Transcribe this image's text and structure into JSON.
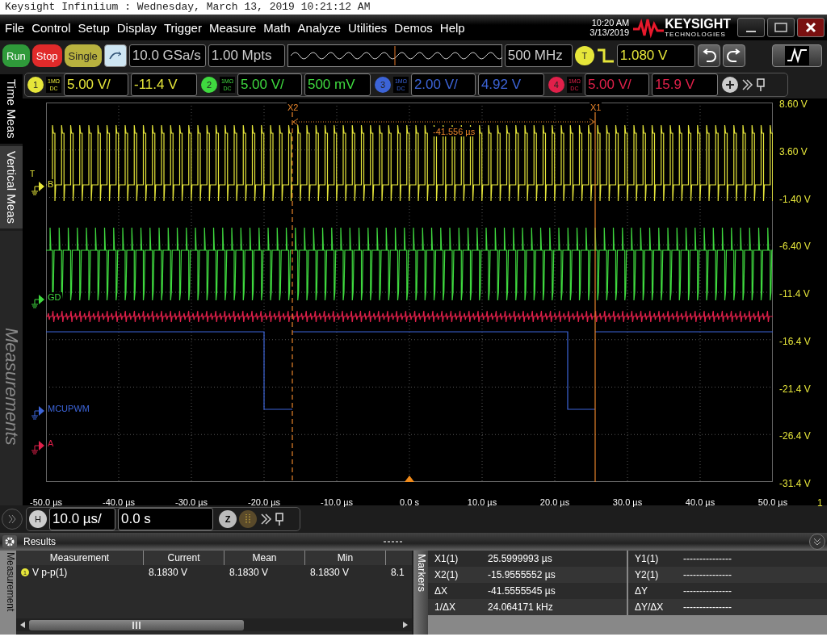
{
  "window_title": "Keysight Infiniium : Wednesday, March 13, 2019 10:21:12 AM",
  "menu": [
    "File",
    "Control",
    "Setup",
    "Display",
    "Trigger",
    "Measure",
    "Math",
    "Analyze",
    "Utilities",
    "Demos",
    "Help"
  ],
  "clock": {
    "time": "10:20 AM",
    "date": "3/13/2019"
  },
  "logo": {
    "name": "KEYSIGHT",
    "subtitle": "TECHNOLOGIES"
  },
  "acquisition": {
    "buttons": [
      {
        "label": "Run",
        "kind": "run"
      },
      {
        "label": "Stop",
        "kind": "stop"
      },
      {
        "label": "Single",
        "kind": "single"
      }
    ],
    "sample_rate": "10.0 GSa/s",
    "memory_depth": "1.00 Mpts",
    "bandwidth": "500 MHz"
  },
  "trigger": {
    "badge": "T",
    "level": "1.080 V",
    "marker": "T"
  },
  "channels": [
    {
      "number": "1",
      "impedance": "1MΩ",
      "coupling": "DC",
      "scale": "5.00 V/",
      "offset": "-11.4 V",
      "label": "B",
      "color": "#e6e63a"
    },
    {
      "number": "2",
      "impedance": "1MΩ",
      "coupling": "DC",
      "scale": "5.00 V/",
      "offset": "500 mV",
      "label": "GD",
      "color": "#3fd93f"
    },
    {
      "number": "3",
      "impedance": "1MΩ",
      "coupling": "DC",
      "scale": "2.00 V/",
      "offset": "4.92 V",
      "label": "MCUPWM",
      "color": "#3c64d8"
    },
    {
      "number": "4",
      "impedance": "1MΩ",
      "coupling": "DC",
      "scale": "5.00 V/",
      "offset": "15.9 V",
      "label": "A",
      "color": "#e0204a"
    }
  ],
  "side_tabs": [
    {
      "label": "Time Meas",
      "selected": true,
      "disabled": false
    },
    {
      "label": "Vertical Meas",
      "selected": false,
      "disabled": false
    },
    {
      "label": "Measurements",
      "selected": false,
      "disabled": true
    }
  ],
  "graticule": {
    "y_labels": [
      "8.60 V",
      "3.60 V",
      "-1.40 V",
      "-6.40 V",
      "-11.4 V",
      "-16.4 V",
      "-21.4 V",
      "-26.4 V",
      "-31.4 V"
    ],
    "x_labels": [
      "-50.0 µs",
      "-40.0 µs",
      "-30.0 µs",
      "-20.0 µs",
      "-10.0 µs",
      "0.0 s",
      "10.0 µs",
      "20.0 µs",
      "30.0 µs",
      "40.0 µs",
      "50.0 µs"
    ],
    "edge_label": "1"
  },
  "cursors": [
    {
      "name": "X2"
    },
    {
      "name": "X1"
    }
  ],
  "cursor_delta": "-41.556 µs",
  "horizontal": {
    "badge": "H",
    "scale": "10.0 µs/",
    "position": "0.0 s",
    "zoom_badge": "Z"
  },
  "results": {
    "title": "Results",
    "side_label": "Measurement",
    "columns": [
      "Measurement",
      "Current",
      "Mean",
      "Min"
    ],
    "rows": [
      {
        "channel": "1",
        "cells": [
          "V p-p(1)",
          "8.1830 V",
          "8.1830 V",
          "8.1830 V",
          "8.1"
        ]
      }
    ]
  },
  "markers": {
    "title": "Markers",
    "rows": [
      {
        "x_label": "X1(1)",
        "x_value": "25.5999993 µs",
        "y_label": "Y1(1)",
        "y_value": "---------------"
      },
      {
        "x_label": "X2(1)",
        "x_value": "-15.9555552 µs",
        "y_label": "Y2(1)",
        "y_value": "---------------"
      },
      {
        "x_label": "ΔX",
        "x_value": "-41.5555545 µs",
        "y_label": "ΔY",
        "y_value": "---------------"
      },
      {
        "x_label": "1/ΔX",
        "x_value": "24.064171 kHz",
        "y_label": "ΔY/ΔX",
        "y_value": "---------------"
      }
    ]
  }
}
